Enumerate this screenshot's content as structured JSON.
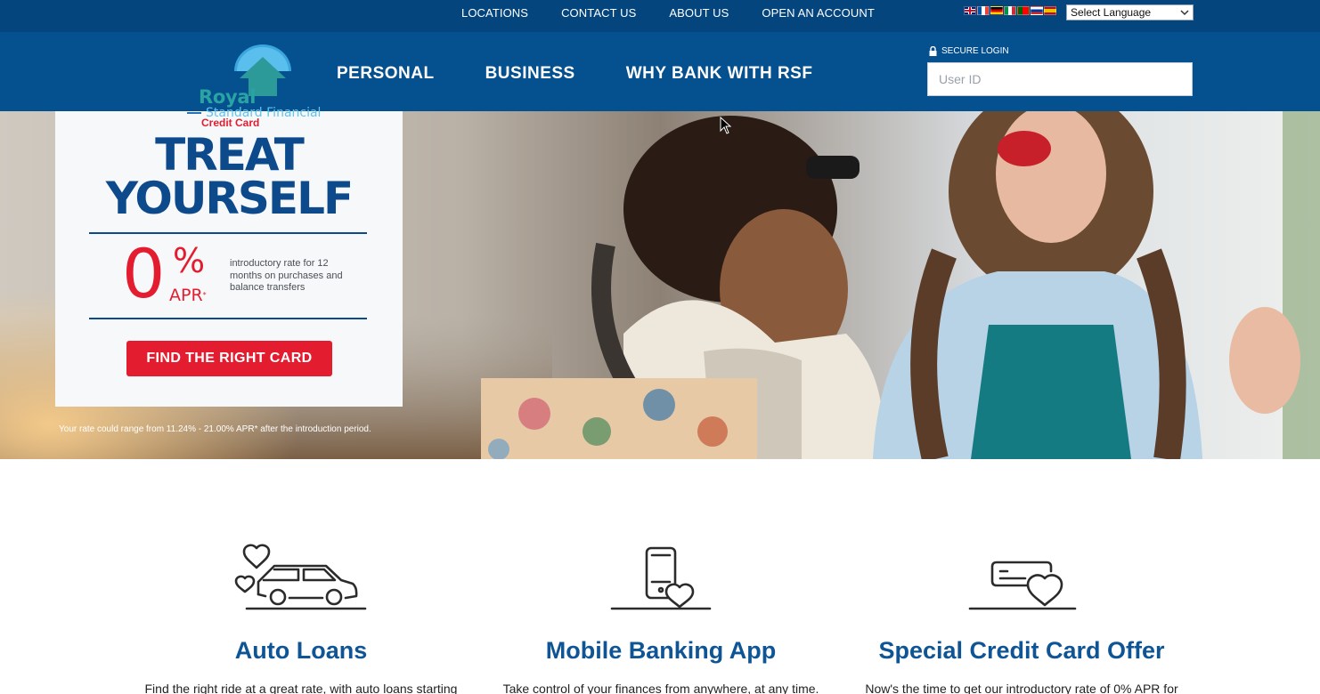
{
  "top_links": [
    "LOCATIONS",
    "CONTACT US",
    "ABOUT US",
    "OPEN AN ACCOUNT"
  ],
  "language": {
    "selected": "Select Language",
    "flags": [
      "en-flag",
      "fr-flag",
      "de-flag",
      "it-flag",
      "pt-flag",
      "ru-flag",
      "es-flag"
    ]
  },
  "brand": {
    "name_primary": "Royal",
    "name_secondary": "Standard Financial"
  },
  "main_nav": [
    "PERSONAL",
    "BUSINESS",
    "WHY BANK WITH RSF"
  ],
  "login": {
    "label": "SECURE LOGIN",
    "placeholder": "User ID"
  },
  "hero": {
    "card_label": "Credit Card",
    "headline_1": "TREAT",
    "headline_2": "YOURSELF",
    "rate_number": "0",
    "rate_percent": "%",
    "rate_suffix": "APR",
    "rate_mark": "*",
    "intro_text": "introductory rate for 12 months on purchases and balance transfers",
    "cta_label": "FIND THE RIGHT CARD",
    "disclaimer": "Your rate could range from 11.24% - 21.00% APR* after the introduction period."
  },
  "features": [
    {
      "icon": "car-hearts-icon",
      "title": "Auto Loans",
      "text": "Find the right ride at a great rate, with auto loans starting"
    },
    {
      "icon": "phone-heart-icon",
      "title": "Mobile Banking App",
      "text": "Take control of your finances from anywhere, at any time."
    },
    {
      "icon": "card-heart-icon",
      "title": "Special Credit Card Offer",
      "text": "Now's the time to get our introductory rate of 0% APR for"
    }
  ],
  "colors": {
    "topbar": "#04457e",
    "navbar": "#05508f",
    "accent_red": "#e31d2f",
    "heading_blue": "#0f5595"
  }
}
